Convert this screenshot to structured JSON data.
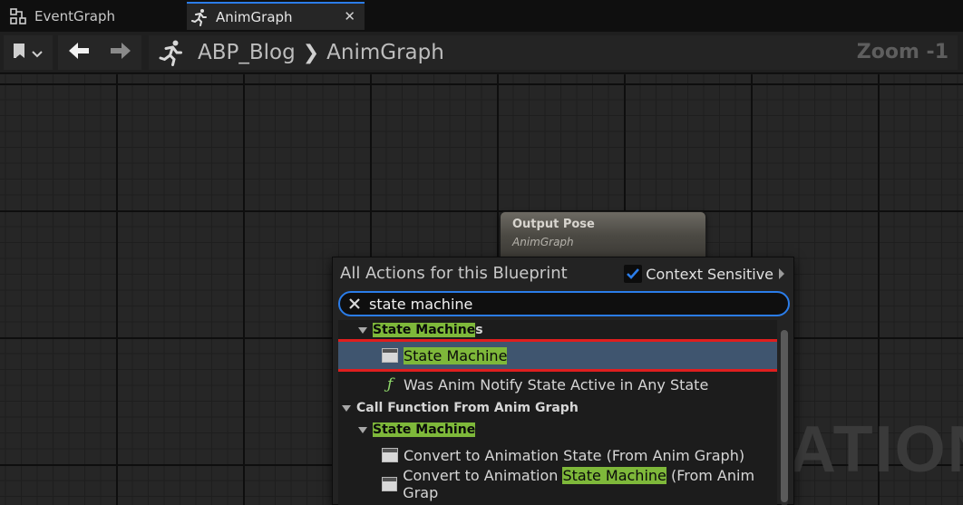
{
  "tabs": [
    {
      "label": "EventGraph",
      "icon": "event-graph-icon"
    },
    {
      "label": "AnimGraph",
      "icon": "running-figure-icon",
      "active": true,
      "close": "✕"
    }
  ],
  "toolbar": {
    "breadcrumb": [
      "ABP_Blog",
      "AnimGraph"
    ],
    "separator": "❯",
    "zoom": "Zoom -1"
  },
  "canvas": {
    "watermark": "ATION"
  },
  "output_node": {
    "title": "Output Pose",
    "subtitle": "AnimGraph"
  },
  "menu": {
    "header": "All Actions for this Blueprint",
    "context_sensitive_label": "Context Sensitive",
    "context_sensitive_checked": true,
    "search_value": "state machine",
    "rows": [
      {
        "kind": "category",
        "level": 1,
        "parts": [
          {
            "t": "State Machine",
            "hl": true
          },
          {
            "t": "s",
            "hl": false
          }
        ]
      },
      {
        "kind": "item",
        "icon": "node",
        "level": 2,
        "selected": true,
        "parts": [
          {
            "t": "State Machine",
            "hl": true
          }
        ]
      },
      {
        "kind": "item",
        "icon": "function",
        "level": 2,
        "parts": [
          {
            "t": "Was Anim Notify State Active in Any State",
            "hl": false
          }
        ]
      },
      {
        "kind": "category",
        "level": 0,
        "parts": [
          {
            "t": "Call Function From Anim Graph",
            "hl": false
          }
        ]
      },
      {
        "kind": "category",
        "level": 1,
        "parts": [
          {
            "t": "State Machine",
            "hl": true
          }
        ]
      },
      {
        "kind": "item",
        "icon": "node",
        "level": 2,
        "parts": [
          {
            "t": "Convert to Animation State (From Anim Graph)",
            "hl": false
          }
        ]
      },
      {
        "kind": "item",
        "icon": "node",
        "level": 2,
        "parts": [
          {
            "t": "Convert to Animation ",
            "hl": false
          },
          {
            "t": "State Machine",
            "hl": true
          },
          {
            "t": " (From Anim Grap",
            "hl": false
          }
        ]
      },
      {
        "kind": "item",
        "icon": "node",
        "level": 2,
        "parts": [
          {
            "t": "",
            "hl": false
          }
        ]
      }
    ]
  },
  "colors": {
    "accent": "#2b7de9",
    "highlight": "#7eb83a",
    "selection_outline": "#e01e1e"
  }
}
